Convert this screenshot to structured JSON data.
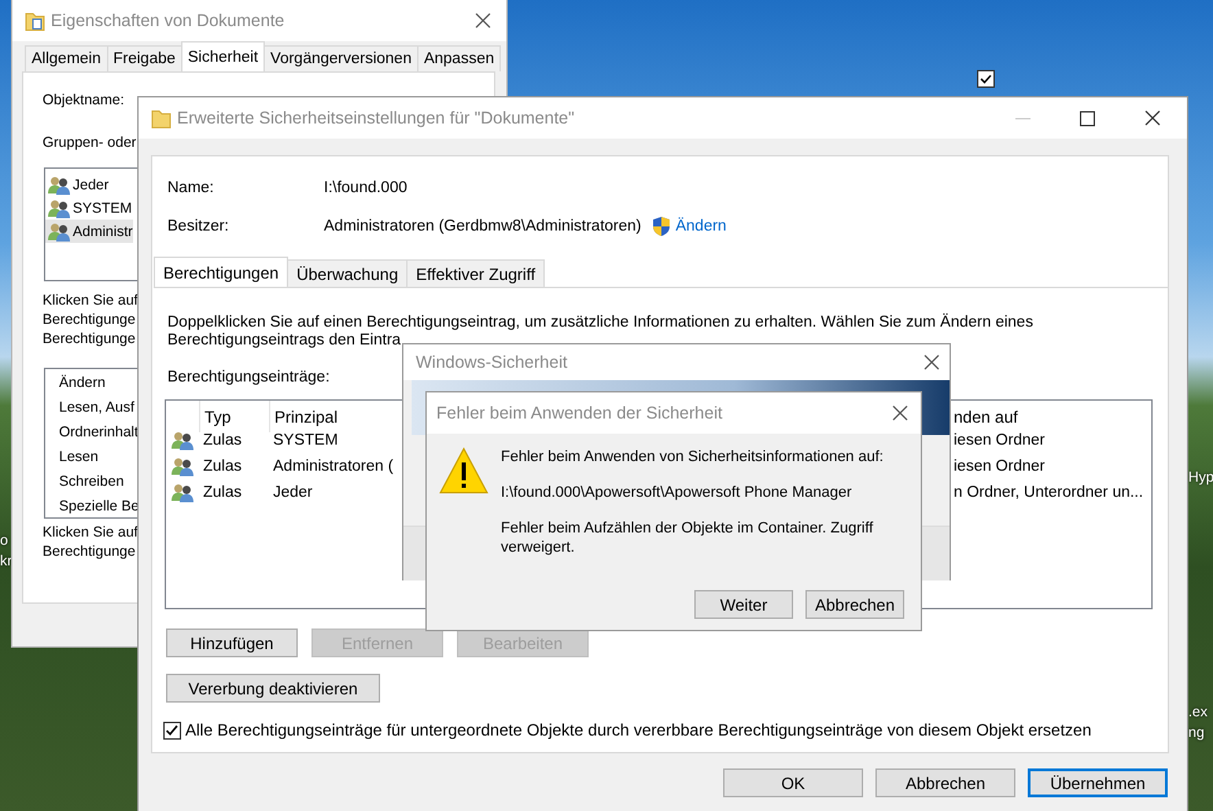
{
  "desktop": {
    "left_edge_labels": [
      "o",
      "kr"
    ],
    "right_edge_labels": [
      "Hyp",
      ".ex",
      "ng"
    ]
  },
  "properties_window": {
    "title": "Eigenschaften von Dokumente",
    "tabs": [
      {
        "label": "Allgemein",
        "selected": false
      },
      {
        "label": "Freigabe",
        "selected": false
      },
      {
        "label": "Sicherheit",
        "selected": true
      },
      {
        "label": "Vorgängerversionen",
        "selected": false
      },
      {
        "label": "Anpassen",
        "selected": false
      }
    ],
    "object_name_label": "Objektname:",
    "groups_label": "Gruppen- oder",
    "groups": [
      {
        "name": "Jeder",
        "selected": false
      },
      {
        "name": "SYSTEM",
        "selected": false
      },
      {
        "name": "Administr",
        "selected": true
      }
    ],
    "hint_lines": [
      "Klicken Sie auf",
      "Berechtigunge",
      "Berechtigunge"
    ],
    "permissions": [
      "Ändern",
      "Lesen, Ausf",
      "Ordnerinhalt",
      "Lesen",
      "Schreiben",
      "Spezielle Be"
    ],
    "hint_lines_2": [
      "Klicken Sie auf",
      "Berechtigunge"
    ]
  },
  "advanced_window": {
    "title": "Erweiterte Sicherheitseinstellungen für \"Dokumente\"",
    "name_label": "Name:",
    "name_value": "I:\\found.000",
    "owner_label": "Besitzer:",
    "owner_value": "Administratoren (Gerdbmw8\\Administratoren)",
    "change_link": "Ändern",
    "tabs": [
      {
        "label": "Berechtigungen",
        "selected": true
      },
      {
        "label": "Überwachung",
        "selected": false
      },
      {
        "label": "Effektiver Zugriff",
        "selected": false
      }
    ],
    "description": [
      "Doppelklicken Sie auf einen Berechtigungseintrag, um zusätzliche Informationen zu erhalten. Wählen Sie zum Ändern eines",
      "Berechtigungseintrags den Eintra"
    ],
    "entries_label": "Berechtigungseinträge:",
    "columns": [
      "Typ",
      "Prinzipal",
      "nden auf"
    ],
    "rows": [
      {
        "type": "Zulas",
        "principal": "SYSTEM",
        "applies_to": "iesen Ordner"
      },
      {
        "type": "Zulas",
        "principal": "Administratoren (",
        "applies_to": "iesen Ordner"
      },
      {
        "type": "Zulas",
        "principal": "Jeder",
        "applies_to": "n Ordner, Unterordner un..."
      }
    ],
    "buttons": [
      {
        "label": "Hinzufügen",
        "disabled": false
      },
      {
        "label": "Entfernen",
        "disabled": true
      },
      {
        "label": "Bearbeiten",
        "disabled": true
      }
    ],
    "inheritance_button": "Vererbung deaktivieren",
    "replace_checkbox": {
      "label": "Alle Berechtigungseinträge für untergeordnete Objekte durch vererbbare Berechtigungseinträge von diesem Objekt ersetzen",
      "checked": true
    },
    "footer_buttons": [
      {
        "label": "OK",
        "default": false
      },
      {
        "label": "Abbrechen",
        "default": false
      },
      {
        "label": "Übernehmen",
        "default": true
      }
    ]
  },
  "security_window": {
    "title": "Windows-Sicherheit"
  },
  "error_dialog": {
    "title": "Fehler beim Anwenden der Sicherheit",
    "message": "Fehler beim Anwenden von Sicherheitsinformationen auf:",
    "path": "I:\\found.000\\Apowersoft\\Apowersoft Phone Manager",
    "detail": "Fehler beim Aufzählen der Objekte im Container. Zugriff verweigert.",
    "buttons": [
      {
        "label": "Weiter",
        "default": false
      },
      {
        "label": "Abbrechen",
        "default": false
      }
    ]
  }
}
